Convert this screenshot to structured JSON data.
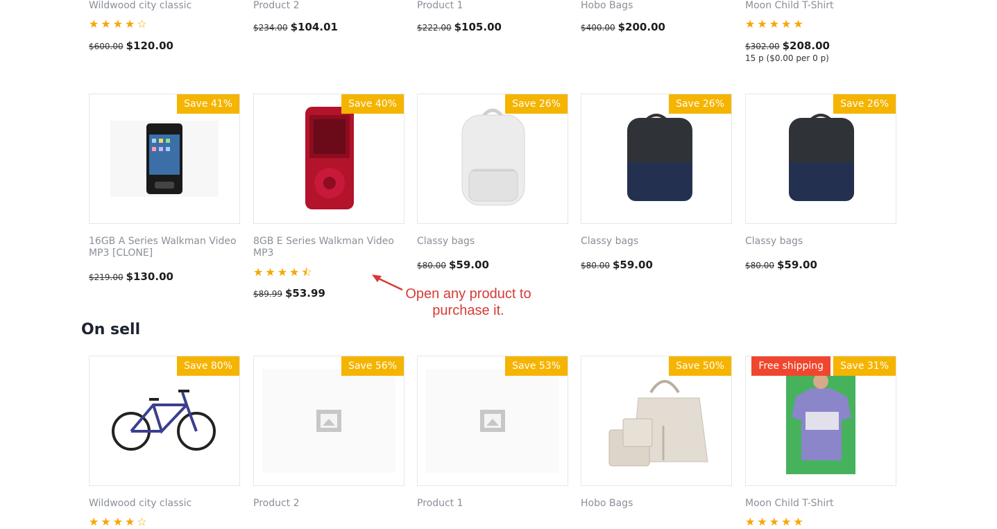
{
  "top_row": [
    {
      "name": "Wildwood city classic",
      "rating": "★★★★☆",
      "old_price": "$600.00",
      "price": "$120.00"
    },
    {
      "name": "Product 2",
      "old_price": "$234.00",
      "price": "$104.01"
    },
    {
      "name": "Product 1",
      "old_price": "$222.00",
      "price": "$105.00"
    },
    {
      "name": "Hobo Bags",
      "old_price": "$400.00",
      "price": "$200.00"
    },
    {
      "name": "Moon Child T-Shirt",
      "rating": "★★★★★",
      "old_price": "$302.00",
      "price": "$208.00",
      "unit_price": "15 p ($0.00 per 0 p)"
    }
  ],
  "middle_row": [
    {
      "badge": "Save 41%",
      "name": "16GB A Series Walkman Video MP3 [CLONE]",
      "old_price": "$219.00",
      "price": "$130.00",
      "icon": "black-mp3-player"
    },
    {
      "badge": "Save 40%",
      "name": "8GB E Series Walkman Video MP3",
      "rating": "★★★★⯪",
      "old_price": "$89.99",
      "price": "$53.99",
      "icon": "red-mp3-player"
    },
    {
      "badge": "Save 26%",
      "name": "Classy bags",
      "old_price": "$80.00",
      "price": "$59.00",
      "icon": "white-backpack"
    },
    {
      "badge": "Save 26%",
      "name": "Classy bags",
      "old_price": "$80.00",
      "price": "$59.00",
      "icon": "navy-backpack"
    },
    {
      "badge": "Save 26%",
      "name": "Classy bags",
      "old_price": "$80.00",
      "price": "$59.00",
      "icon": "navy-backpack"
    }
  ],
  "annotation": "Open any product to purchase it.",
  "section_title": "On sell",
  "bottom_row": [
    {
      "badge": "Save 80%",
      "name": "Wildwood city classic",
      "rating": "★★★★☆",
      "icon": "bicycle"
    },
    {
      "badge": "Save 56%",
      "name": "Product 2",
      "icon": "image-placeholder"
    },
    {
      "badge": "Save 53%",
      "name": "Product 1",
      "icon": "image-placeholder"
    },
    {
      "badge": "Save 50%",
      "name": "Hobo Bags",
      "icon": "handbag-set"
    },
    {
      "badge": "Save 31%",
      "badge_extra": "Free shipping",
      "name": "Moon Child T-Shirt",
      "rating": "★★★★★",
      "icon": "tshirt-model"
    }
  ],
  "colors": {
    "badge": "#f5b400",
    "free_shipping": "#f0462f",
    "star": "#f5a700",
    "annotation": "#d63a35"
  }
}
